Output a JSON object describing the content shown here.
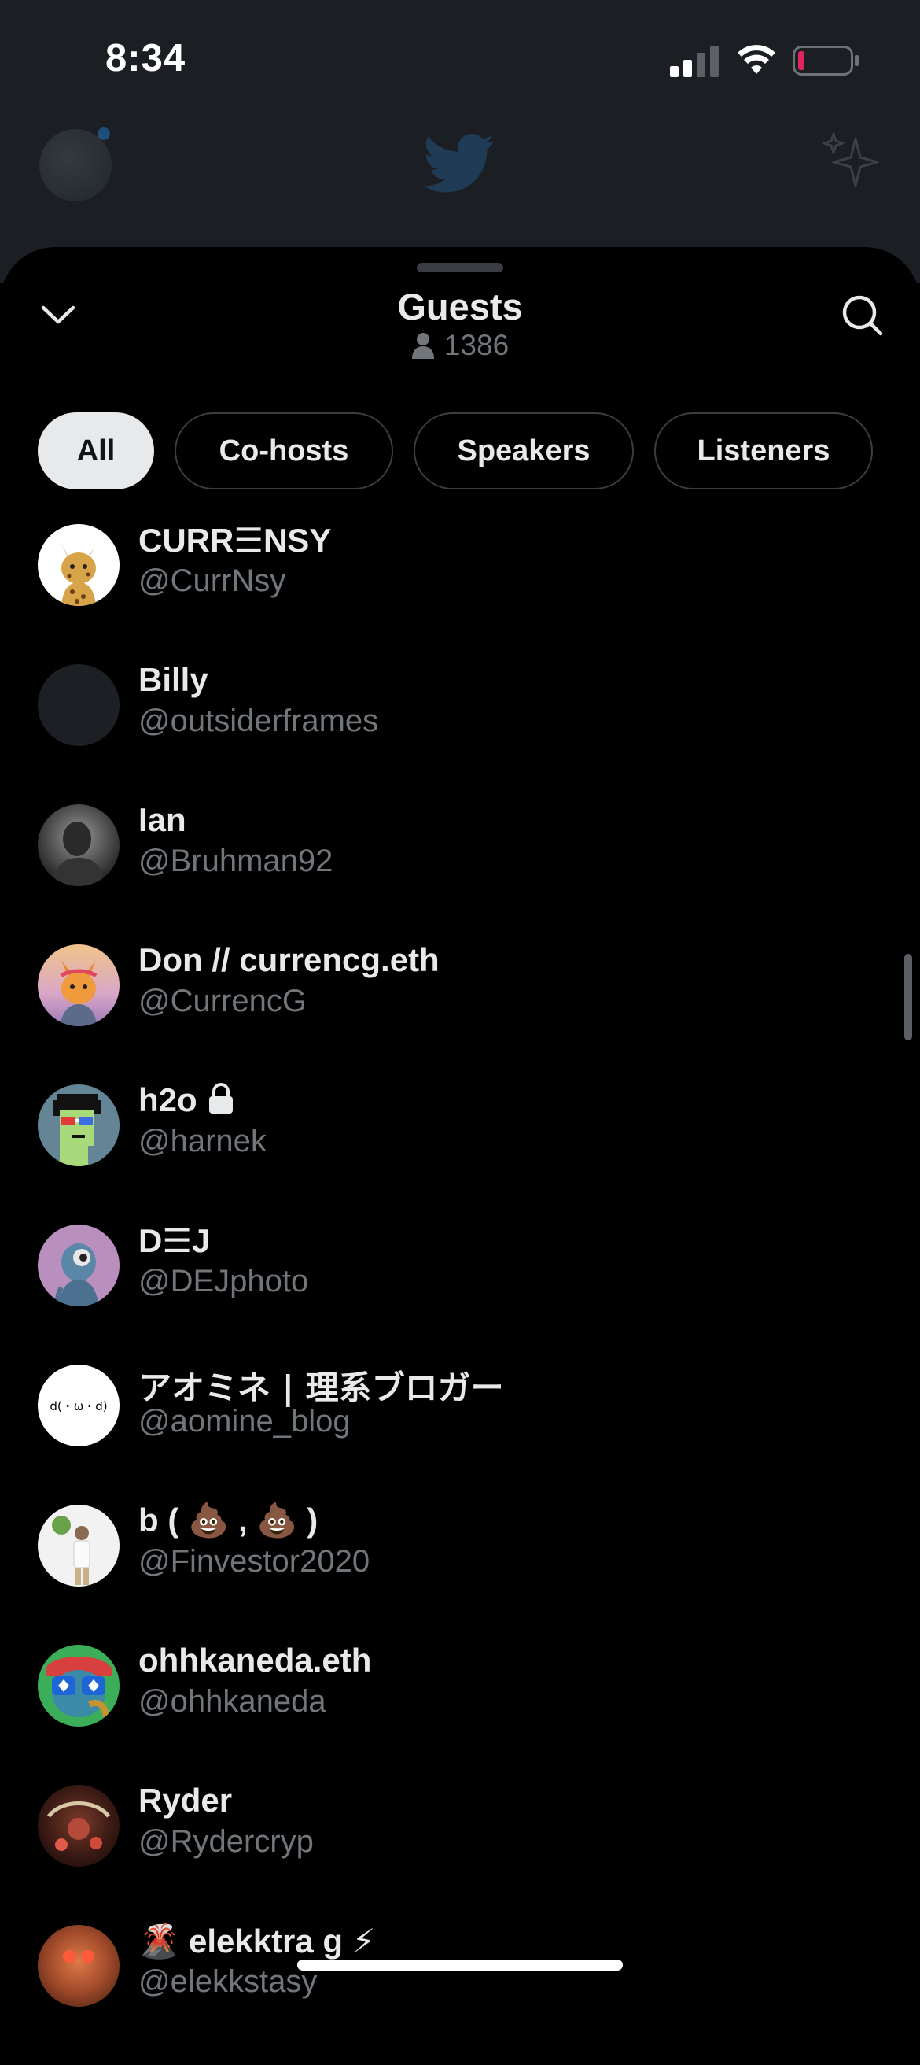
{
  "status_bar": {
    "time": "8:34"
  },
  "sheet": {
    "title": "Guests",
    "count": "1386",
    "icons": {
      "collapse": "chevron-down-icon",
      "search": "search-icon",
      "count": "person-icon"
    }
  },
  "tabs": [
    {
      "label": "All",
      "active": true
    },
    {
      "label": "Co-hosts",
      "active": false
    },
    {
      "label": "Speakers",
      "active": false
    },
    {
      "label": "Listeners",
      "active": false
    }
  ],
  "guests": [
    {
      "name": "CURR☰NSY",
      "handle": "@CurrNsy"
    },
    {
      "name": "Billy",
      "handle": "@outsiderframes"
    },
    {
      "name": "Ian",
      "handle": "@Bruhman92"
    },
    {
      "name": "Don // currencg.eth",
      "handle": "@CurrencG"
    },
    {
      "name": "h2o",
      "handle": "@harnek"
    },
    {
      "name": "D☰J",
      "handle": "@DEJphoto"
    },
    {
      "name": "アオミネ | 理系ブロガー",
      "handle": "@aomine_blog"
    },
    {
      "name": "b ( 💩 , 💩 )",
      "handle": "@Finvestor2020"
    },
    {
      "name": "ohhkaneda.eth",
      "handle": "@ohhkaneda"
    },
    {
      "name": "Ryder",
      "handle": "@Rydercryp"
    },
    {
      "name": "🌋 elekktra g ⚡",
      "handle": "@elekkstasy"
    }
  ],
  "avatar_misc": {
    "aomine_text": "d(・ω・d)"
  },
  "colors": {
    "background": "#000000",
    "text_primary": "#e7e9ea",
    "text_secondary": "#71767b",
    "tab_border": "#3a3d42",
    "battery_low": "#e0245e"
  }
}
